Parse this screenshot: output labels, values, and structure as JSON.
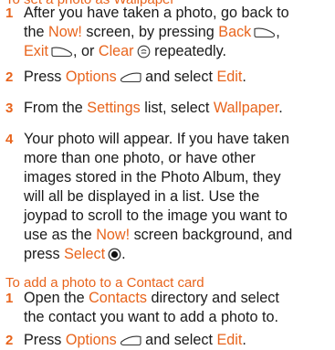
{
  "section1": {
    "heading": "To set a photo as Wallpaper",
    "steps": [
      {
        "number": "1",
        "lines": [
          [
            "After you have taken a photo, go back to"
          ],
          [
            "the ",
            "Now!",
            " screen, by pressing ",
            "Back"
          ],
          [
            "Exit",
            ", or ",
            "Clear",
            " repeatedly."
          ]
        ]
      },
      {
        "number": "2",
        "lines": [
          [
            "Press ",
            "Options",
            " and select ",
            "Edit",
            "."
          ]
        ]
      },
      {
        "number": "3",
        "lines": [
          [
            "From the ",
            "Settings",
            " list, select ",
            "Wallpaper",
            "."
          ]
        ]
      },
      {
        "number": "4",
        "lines": [
          [
            "Your photo will appear. If you have taken"
          ],
          [
            "more than one photo, or have other"
          ],
          [
            "images stored in the Photo Album, they"
          ],
          [
            "will all be displayed in a list. Use the"
          ],
          [
            "joypad to scroll to the image you want to"
          ],
          [
            "use as the ",
            "Now!",
            " screen background, and"
          ],
          [
            "press ",
            "Select"
          ]
        ]
      }
    ]
  },
  "section2": {
    "heading": "To add a photo to a Contact card",
    "steps": [
      {
        "number": "1",
        "lines": [
          [
            "Open the ",
            "Contacts",
            " directory and select"
          ],
          [
            "the contact you want to add a photo to."
          ]
        ]
      },
      {
        "number": "2",
        "lines": [
          [
            "Press ",
            "Options",
            " and select ",
            "Edit",
            "."
          ]
        ]
      }
    ]
  },
  "colors": {
    "accent": "#e8641c",
    "text": "#1a1a1a"
  },
  "icons": {
    "back": "softkey-right-icon",
    "exit": "softkey-right-icon",
    "clear": "clear-key-icon",
    "options": "softkey-left-icon",
    "select": "joypad-center-icon"
  }
}
